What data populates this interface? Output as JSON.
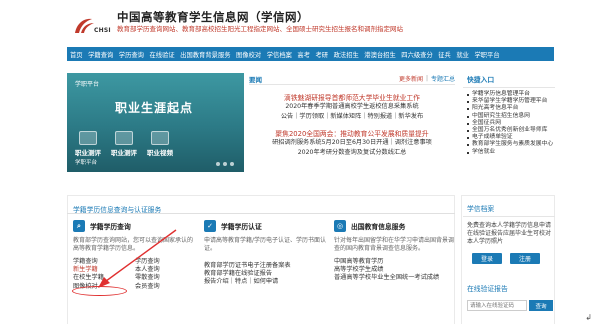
{
  "header": {
    "logo_text": "CHSI",
    "title": "中国高等教育学生信息网（学信网）",
    "desc": "教育部学历查询网站、教育部高校招生阳光工程指定网站、全国硕士研究生招生报名和调剂指定网站"
  },
  "nav": [
    "首页",
    "学籍查询",
    "学历查询",
    "在线验证",
    "出国教育背景服务",
    "图像校对",
    "学信档案",
    "高考",
    "考研",
    "政法招生",
    "港澳台招生",
    "四六级查分",
    "征兵",
    "就业",
    "学职平台"
  ],
  "banner": {
    "logo": "学职平台",
    "title": "职业生涯起点",
    "buttons": [
      "职业测评",
      "职业测评",
      "职业视频"
    ],
    "bottom": "学职平台"
  },
  "news": {
    "tab": "要闻",
    "more": "更多新闻",
    "special": "专题汇总",
    "block1": {
      "headline": "滴铁魅湖研报导首都师范大学毕业生就业工作",
      "lines": [
        "2020年春季学期普通高校学生返校信息采集系统",
        "公告｜学历领取｜新媒体矩阵｜特别报道｜新华发布"
      ]
    },
    "block2": {
      "headline": "聚焦2020全国两会：推动教育公平发展和质量提升",
      "lines": [
        "研招调剂服务系统5月20日至6月30日开通｜调剂注意事项",
        "2020年考研分数查询及复试分数线汇总"
      ]
    }
  },
  "quick": {
    "title": "快捷入口",
    "items": [
      "学籍学历信息管理平台",
      "来华留学生学籍学历管理平台",
      "阳光高考信息平台",
      "中国研究生招生信息网",
      "全国征兵网",
      "全国万名优秀创新创业导师库",
      "电子成绩单验证",
      "教育部学生服务与素质发展中心",
      "学信就业"
    ]
  },
  "section": {
    "title": "学籍学历信息查询与认证服务"
  },
  "col1": {
    "head": "学籍学历查询",
    "desc": "教育部学历查询网站，您可以查询国家承认的高等教育学籍学历信息。",
    "links": [
      [
        "学籍查询",
        "学历查询"
      ],
      [
        "新生学籍",
        "本人查询"
      ],
      [
        "在校生学籍",
        "零散查询"
      ],
      [
        "图像校对",
        "会员查询"
      ]
    ]
  },
  "col2": {
    "head": "学籍学历认证",
    "desc": "申请高等教育学籍/学历电子认证、学历书面认证。",
    "links": [
      "教育部学历证书电子注册备案表",
      "教育部学籍在线验证报告",
      "报告介绍｜特点｜如何申请"
    ]
  },
  "col3": {
    "head": "出国教育信息服务",
    "desc": "针对每年出国留学和在华学习申请出国背景调查的国内教育背景调查信息服务。",
    "links": [
      "中国高等教育学历",
      "高等学校学生成绩",
      "普通高等学校毕业生全国统一考试成绩"
    ]
  },
  "side2": {
    "title": "学信档案",
    "text": "免费查询本人学籍学历信息申请在线验证报告应届毕业生可校对本人学历照片",
    "login": "登录",
    "register": "注册"
  },
  "verify": {
    "title": "在线验证报告",
    "placeholder": "请输入在线验证码",
    "button": "查询"
  },
  "pilcrow": "↲"
}
